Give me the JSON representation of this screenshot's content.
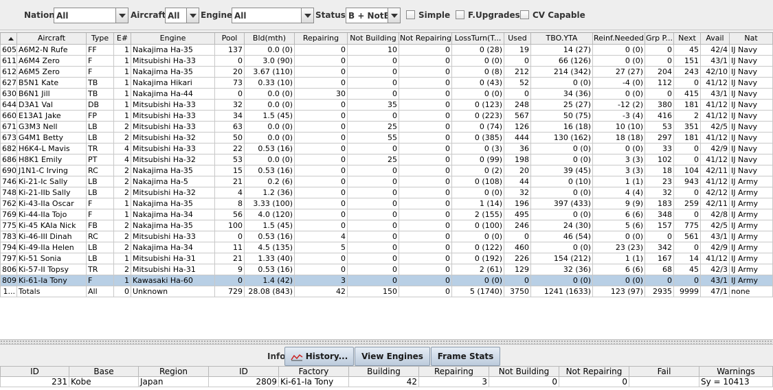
{
  "filters": {
    "nation_label": "Nation:",
    "nation_value": "All",
    "aircraft_label": "Aircraft:",
    "aircraft_value": "All",
    "engine_label": "Engine:",
    "engine_value": "All",
    "status_label": "Status:",
    "status_value": "B + NotB",
    "simple_label": "Simple",
    "fupgrades_label": "F.Upgrades",
    "cvcapable_label": "CV Capable"
  },
  "table": {
    "columns": [
      "",
      "Aircraft",
      "Type",
      "E#",
      "Engine",
      "Pool",
      "Bld(mth)",
      "Repairing",
      "Not Building",
      "Not Repairing",
      "LossTurn(T...",
      "Used",
      "TBO.YTA",
      "Reinf.Needed",
      "Grp P...",
      "Next",
      "Avail",
      "Nat"
    ],
    "rows": [
      [
        "605",
        "A6M2-N Rufe",
        "FF",
        "1",
        "Nakajima Ha-35",
        "137",
        "0.0 (0)",
        "0",
        "10",
        "0",
        "0 (28)",
        "19",
        "14 (27)",
        "0 (0)",
        "0",
        "45",
        "42/4",
        "IJ Navy"
      ],
      [
        "611",
        "A6M4 Zero",
        "F",
        "1",
        "Mitsubishi Ha-33",
        "0",
        "3.0 (90)",
        "0",
        "0",
        "0",
        "0 (0)",
        "0",
        "66 (126)",
        "0 (0)",
        "0",
        "151",
        "43/1",
        "IJ Navy"
      ],
      [
        "612",
        "A6M5 Zero",
        "F",
        "1",
        "Nakajima Ha-35",
        "20",
        "3.67 (110)",
        "0",
        "0",
        "0",
        "0 (8)",
        "212",
        "214 (342)",
        "27 (27)",
        "204",
        "243",
        "42/10",
        "IJ Navy"
      ],
      [
        "627",
        "B5N1 Kate",
        "TB",
        "1",
        "Nakajima Hikari",
        "73",
        "0.33 (10)",
        "0",
        "0",
        "0",
        "0 (43)",
        "52",
        "0 (0)",
        "-4 (0)",
        "112",
        "0",
        "41/12",
        "IJ Navy"
      ],
      [
        "630",
        "B6N1 Jill",
        "TB",
        "1",
        "Nakajima Ha-44",
        "0",
        "0.0 (0)",
        "30",
        "0",
        "0",
        "0 (0)",
        "0",
        "34 (36)",
        "0 (0)",
        "0",
        "415",
        "43/1",
        "IJ Navy"
      ],
      [
        "644",
        "D3A1 Val",
        "DB",
        "1",
        "Mitsubishi Ha-33",
        "32",
        "0.0 (0)",
        "0",
        "35",
        "0",
        "0 (123)",
        "248",
        "25 (27)",
        "-12 (2)",
        "380",
        "181",
        "41/12",
        "IJ Navy"
      ],
      [
        "660",
        "E13A1 Jake",
        "FP",
        "1",
        "Mitsubishi Ha-33",
        "34",
        "1.5 (45)",
        "0",
        "0",
        "0",
        "0 (223)",
        "567",
        "50 (75)",
        "-3 (4)",
        "416",
        "2",
        "41/12",
        "IJ Navy"
      ],
      [
        "671",
        "G3M3 Nell",
        "LB",
        "2",
        "Mitsubishi Ha-33",
        "63",
        "0.0 (0)",
        "0",
        "25",
        "0",
        "0 (74)",
        "126",
        "16 (18)",
        "10 (10)",
        "53",
        "351",
        "42/5",
        "IJ Navy"
      ],
      [
        "673",
        "G4M1 Betty",
        "LB",
        "2",
        "Mitsubishi Ha-32",
        "50",
        "0.0 (0)",
        "0",
        "55",
        "0",
        "0 (385)",
        "444",
        "130 (162)",
        "18 (18)",
        "297",
        "181",
        "41/12",
        "IJ Navy"
      ],
      [
        "682",
        "H6K4-L Mavis",
        "TR",
        "4",
        "Mitsubishi Ha-33",
        "22",
        "0.53 (16)",
        "0",
        "0",
        "0",
        "0 (3)",
        "36",
        "0 (0)",
        "0 (0)",
        "33",
        "0",
        "42/9",
        "IJ Navy"
      ],
      [
        "686",
        "H8K1 Emily",
        "PT",
        "4",
        "Mitsubishi Ha-32",
        "53",
        "0.0 (0)",
        "0",
        "25",
        "0",
        "0 (99)",
        "198",
        "0 (0)",
        "3 (3)",
        "102",
        "0",
        "41/12",
        "IJ Navy"
      ],
      [
        "690",
        "J1N1-C Irving",
        "RC",
        "2",
        "Nakajima Ha-35",
        "15",
        "0.53 (16)",
        "0",
        "0",
        "0",
        "0 (2)",
        "20",
        "39 (45)",
        "3 (3)",
        "18",
        "104",
        "42/11",
        "IJ Navy"
      ],
      [
        "746",
        "Ki-21-Ic Sally",
        "LB",
        "2",
        "Nakajima Ha-5",
        "21",
        "0.2 (6)",
        "0",
        "0",
        "0",
        "0 (108)",
        "44",
        "0 (10)",
        "1 (1)",
        "23",
        "943",
        "41/12",
        "IJ Army"
      ],
      [
        "748",
        "Ki-21-IIb Sally",
        "LB",
        "2",
        "Mitsubishi Ha-32",
        "4",
        "1.2 (36)",
        "0",
        "0",
        "0",
        "0 (0)",
        "32",
        "0 (0)",
        "4 (4)",
        "32",
        "0",
        "42/12",
        "IJ Army"
      ],
      [
        "762",
        "Ki-43-IIa Oscar",
        "F",
        "1",
        "Nakajima Ha-35",
        "8",
        "3.33 (100)",
        "0",
        "0",
        "0",
        "1 (14)",
        "196",
        "397 (433)",
        "9 (9)",
        "183",
        "259",
        "42/11",
        "IJ Army"
      ],
      [
        "769",
        "Ki-44-IIa Tojo",
        "F",
        "1",
        "Nakajima Ha-34",
        "56",
        "4.0 (120)",
        "0",
        "0",
        "0",
        "2 (155)",
        "495",
        "0 (0)",
        "6 (6)",
        "348",
        "0",
        "42/8",
        "IJ Army"
      ],
      [
        "775",
        "Ki-45 KAIa Nick",
        "FB",
        "2",
        "Nakajima Ha-35",
        "100",
        "1.5 (45)",
        "0",
        "0",
        "0",
        "0 (100)",
        "246",
        "24 (30)",
        "5 (6)",
        "157",
        "775",
        "42/5",
        "IJ Army"
      ],
      [
        "783",
        "Ki-46-III Dinah",
        "RC",
        "2",
        "Mitsubishi Ha-33",
        "0",
        "0.53 (16)",
        "4",
        "0",
        "0",
        "0 (0)",
        "0",
        "46 (54)",
        "0 (0)",
        "0",
        "561",
        "43/1",
        "IJ Army"
      ],
      [
        "794",
        "Ki-49-IIa Helen",
        "LB",
        "2",
        "Nakajima Ha-34",
        "11",
        "4.5 (135)",
        "5",
        "0",
        "0",
        "0 (122)",
        "460",
        "0 (0)",
        "23 (23)",
        "342",
        "0",
        "42/9",
        "IJ Army"
      ],
      [
        "797",
        "Ki-51 Sonia",
        "LB",
        "1",
        "Mitsubishi Ha-31",
        "21",
        "1.33 (40)",
        "0",
        "0",
        "0",
        "0 (192)",
        "226",
        "154 (212)",
        "1 (1)",
        "167",
        "14",
        "41/12",
        "IJ Army"
      ],
      [
        "806",
        "Ki-57-II Topsy",
        "TR",
        "2",
        "Mitsubishi Ha-31",
        "9",
        "0.53 (16)",
        "0",
        "0",
        "0",
        "2 (61)",
        "129",
        "32 (36)",
        "6 (6)",
        "68",
        "45",
        "42/3",
        "IJ Army"
      ],
      [
        "809",
        "Ki-61-Ia Tony",
        "F",
        "1",
        "Kawasaki Ha-60",
        "0",
        "1.4 (42)",
        "3",
        "0",
        "0",
        "0 (0)",
        "0",
        "0 (0)",
        "0 (0)",
        "0",
        "0",
        "43/1",
        "IJ Army"
      ],
      [
        "1...",
        "Totals",
        "All",
        "0",
        "Unknown",
        "729",
        "28.08 (843)",
        "42",
        "150",
        "0",
        "5 (1740)",
        "3750",
        "1241 (1633)",
        "123 (97)",
        "2935",
        "9999",
        "47/1",
        "none"
      ]
    ]
  },
  "info": {
    "label": "Info:",
    "history_button": "History...",
    "view_engines_button": "View Engines",
    "frame_stats_button": "Frame Stats"
  },
  "detail": {
    "columns": [
      "ID",
      "Base",
      "Region",
      "ID",
      "Factory",
      "Building",
      "Repairing",
      "Not Building",
      "Not Repairing",
      "Fail",
      "Warnings"
    ],
    "row": [
      "231",
      "Kobe",
      "Japan",
      "2809",
      "Ki-61-Ia Tony",
      "42",
      "3",
      "0",
      "0",
      "",
      "Sy = 10413"
    ]
  },
  "colors": {
    "selected_row": "#b8cfe5",
    "button_top": "#e6edf5",
    "button_bottom": "#bccbdc",
    "history_icon": "#cc2222"
  }
}
